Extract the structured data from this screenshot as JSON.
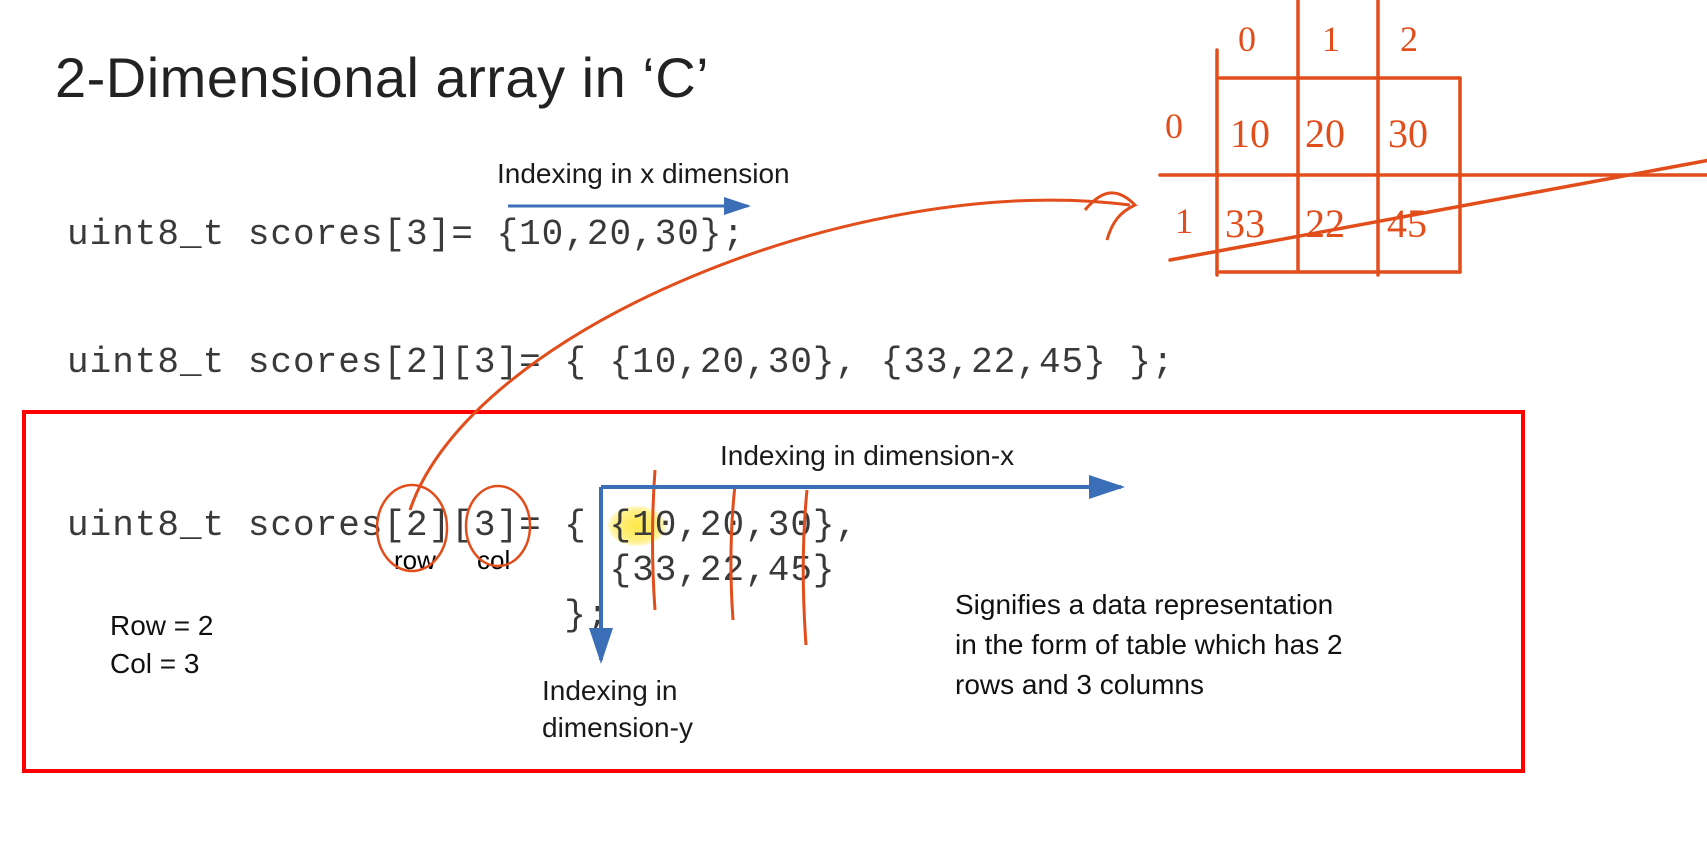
{
  "title": "2-Dimensional array in ‘C’",
  "label_indexing_x_top": "Indexing in x dimension",
  "code_1d": "uint8_t scores[3]= {10,20,30};",
  "code_2d_inline": "uint8_t scores[2][3]= { {10,20,30}, {33,22,45} };",
  "code_2d_block_l1": "uint8_t scores[2][3]= { {10,20,30},",
  "code_2d_block_l2": "                        {33,22,45}",
  "code_2d_block_l3": "                      };",
  "row_label": "row",
  "col_label": "col",
  "rowcol_l1": "Row = 2",
  "rowcol_l2": "Col =  3",
  "label_indexing_x2": "Indexing in  dimension-x",
  "label_indexing_y_l1": "Indexing in",
  "label_indexing_y_l2": "dimension-y",
  "signify_l1": "Signifies a data representation",
  "signify_l2": "in the form of table which has 2",
  "signify_l3": "rows and 3 columns",
  "hand_table": {
    "col_headers": [
      "0",
      "1",
      "2"
    ],
    "row_headers": [
      "0",
      "1"
    ],
    "cells": [
      [
        "10",
        "20",
        "30"
      ],
      [
        "33",
        "22",
        "45"
      ]
    ]
  }
}
